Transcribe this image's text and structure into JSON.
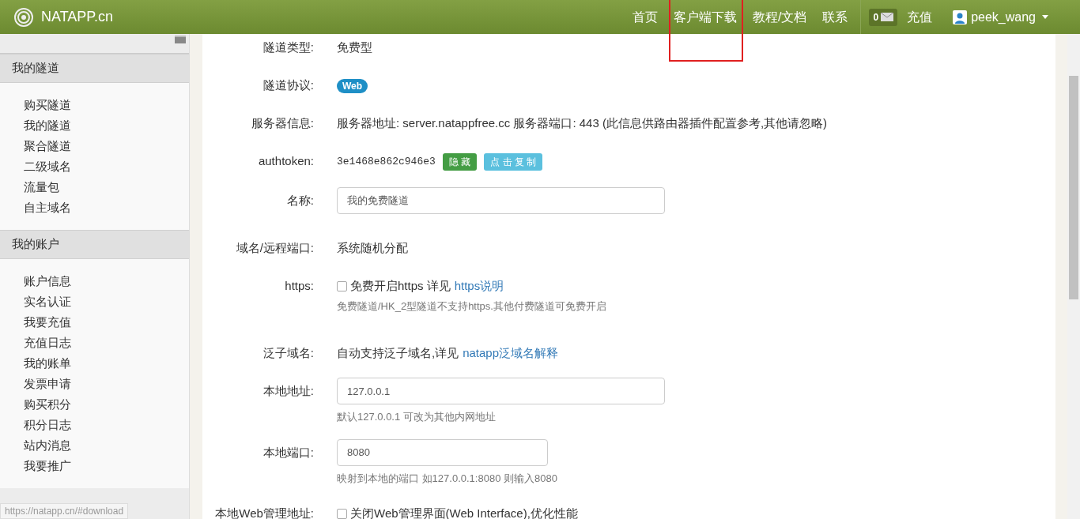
{
  "header": {
    "logo_text": "NATAPP.cn",
    "nav": [
      {
        "label": "首页",
        "annotated": false
      },
      {
        "label": "客户端下载",
        "annotated": true
      },
      {
        "label": "教程/文档",
        "annotated": false
      },
      {
        "label": "联系",
        "annotated": false
      }
    ],
    "message_count": "0",
    "recharge": "充值",
    "user": "peek_wang"
  },
  "sidebar": {
    "sections": [
      {
        "title": "我的隧道",
        "items": [
          "购买隧道",
          "我的隧道",
          "聚合隧道",
          "二级域名",
          "流量包",
          "自主域名"
        ]
      },
      {
        "title": "我的账户",
        "items": [
          "账户信息",
          "实名认证",
          "我要充值",
          "充值日志",
          "我的账单",
          "发票申请",
          "购买积分",
          "积分日志",
          "站内消息",
          "我要推广"
        ]
      }
    ]
  },
  "form": [
    {
      "kind": "text",
      "label": "隧道类型:",
      "value": "免费型"
    },
    {
      "kind": "badge",
      "label": "隧道协议:",
      "value": "Web"
    },
    {
      "kind": "text",
      "label": "服务器信息:",
      "value": "服务器地址: server.natappfree.cc 服务器端口: 443 (此信息供路由器插件配置参考,其他请忽略)"
    },
    {
      "kind": "token",
      "label": "authtoken:",
      "value": "3e1468e862c946e3",
      "buttons": [
        {
          "label": "隐 藏",
          "color": "#449d44"
        },
        {
          "label": "点 击 复 制",
          "color": "#5bc0de"
        }
      ]
    },
    {
      "kind": "input",
      "label": "名称:",
      "value": "我的免费隧道"
    },
    {
      "kind": "text",
      "label": "域名/远程端口:",
      "value": "系统随机分配"
    },
    {
      "kind": "checkbox",
      "label": "https:",
      "checked": false,
      "value": "免费开启https 详见",
      "link": "https说明",
      "help": "免费隧道/HK_2型隧道不支持https.其他付费隧道可免费开启"
    },
    {
      "kind": "text_link",
      "label": "泛子域名:",
      "value": "自动支持泛子域名,详见",
      "link": "natapp泛域名解释"
    },
    {
      "kind": "input",
      "label": "本地地址:",
      "value": "127.0.0.1",
      "help": "默认127.0.0.1 可改为其他内网地址"
    },
    {
      "kind": "short_input",
      "label": "本地端口:",
      "value": "8080",
      "help": "映射到本地的端口 如127.0.0.1:8080 则输入8080"
    },
    {
      "kind": "checkbox",
      "label": "本地Web管理地址:",
      "checked": false,
      "value": "关闭Web管理界面(Web Interface),优化性能"
    }
  ],
  "status_url": "https://natapp.cn/#download"
}
